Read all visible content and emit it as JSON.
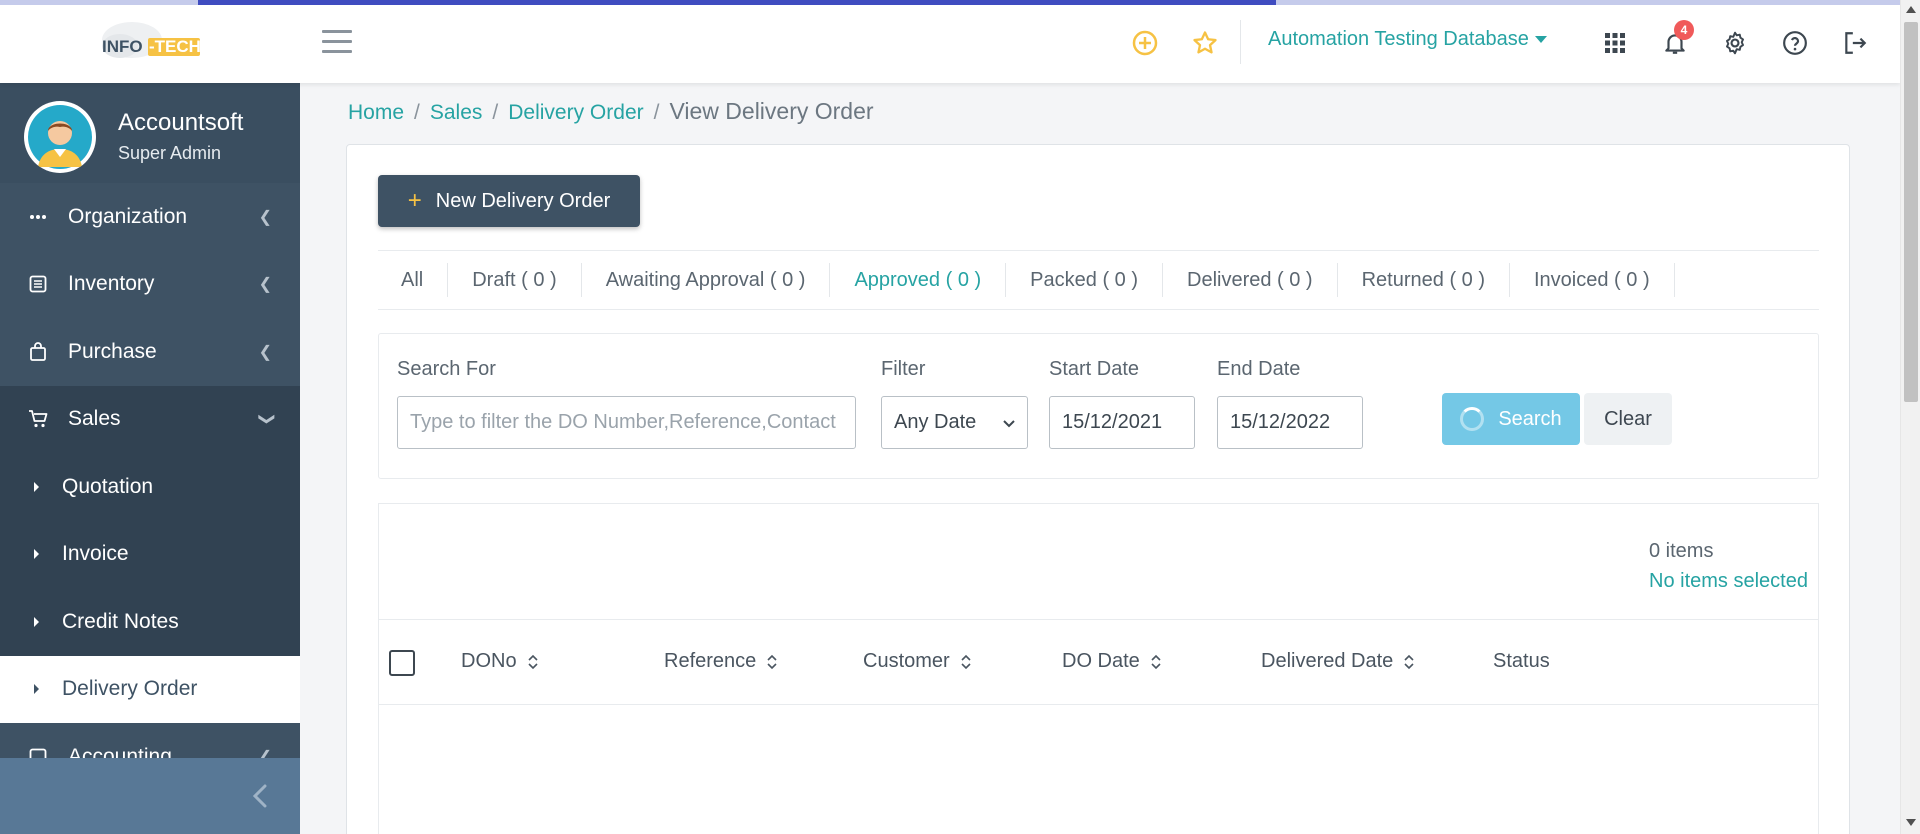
{
  "colors": {
    "accent": "#26a3a3",
    "sidebar": "#3e5264",
    "progress": "#3f4cc0",
    "search_button": "#74c8e6",
    "badge": "#f05a5a",
    "star": "#f6c244"
  },
  "page_load_progress": 0.61,
  "header": {
    "logo_text": "INFO-TECH",
    "database_label": "Automation Testing Database",
    "notification_count": "4",
    "icons": [
      "menu-icon",
      "add-circle-icon",
      "star-icon",
      "apps-grid-icon",
      "bell-icon",
      "gear-icon",
      "help-icon",
      "logout-icon"
    ]
  },
  "sidebar": {
    "user_name": "Accountsoft",
    "user_role": "Super Admin",
    "items": [
      {
        "label": "Organization",
        "icon": "dots-icon"
      },
      {
        "label": "Inventory",
        "icon": "inventory-icon"
      },
      {
        "label": "Purchase",
        "icon": "purchase-bag-icon"
      },
      {
        "label": "Sales",
        "icon": "cart-icon"
      }
    ],
    "sales_sub": [
      {
        "label": "Quotation"
      },
      {
        "label": "Invoice"
      },
      {
        "label": "Credit Notes"
      },
      {
        "label": "Delivery Order"
      }
    ],
    "partial_item": "Accounting"
  },
  "breadcrumb": {
    "home": "Home",
    "sales": "Sales",
    "delivery_order": "Delivery Order",
    "current": "View Delivery Order"
  },
  "actions": {
    "new_button": "New Delivery Order"
  },
  "tabs": [
    {
      "label": "All"
    },
    {
      "label": "Draft ( 0 )"
    },
    {
      "label": "Awaiting Approval ( 0 )"
    },
    {
      "label": "Approved ( 0 )"
    },
    {
      "label": "Packed ( 0 )"
    },
    {
      "label": "Delivered ( 0 )"
    },
    {
      "label": "Returned ( 0 )"
    },
    {
      "label": "Invoiced ( 0 )"
    }
  ],
  "filters": {
    "search_label": "Search For",
    "search_placeholder": "Type to filter the DO Number,Reference,Contact",
    "filter_label": "Filter",
    "filter_value": "Any Date",
    "start_label": "Start Date",
    "start_value": "15/12/2021",
    "end_label": "End Date",
    "end_value": "15/12/2022",
    "search_button": "Search",
    "clear_button": "Clear"
  },
  "table": {
    "items_count": "0 items",
    "selection_status": "No items selected",
    "columns": [
      "DONo",
      "Reference",
      "Customer",
      "DO Date",
      "Delivered Date",
      "Status"
    ],
    "rows": []
  }
}
